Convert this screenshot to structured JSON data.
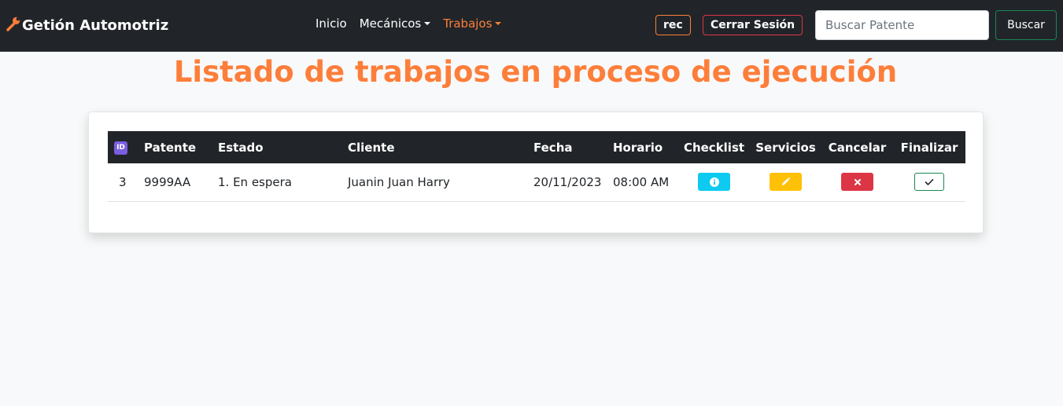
{
  "navbar": {
    "brand": "Getión Automotriz",
    "links": [
      {
        "label": "Inicio"
      },
      {
        "label": "Mecánicos"
      },
      {
        "label": "Trabajos"
      }
    ],
    "user": "rec",
    "logout": "Cerrar Sesión",
    "search_placeholder": "Buscar Patente",
    "search_button": "Buscar"
  },
  "page": {
    "title": "Listado de trabajos en proceso de ejecución"
  },
  "table": {
    "headers": {
      "id_icon": "ID",
      "patente": "Patente",
      "estado": "Estado",
      "cliente": "Cliente",
      "fecha": "Fecha",
      "horario": "Horario",
      "checklist": "Checklist",
      "servicios": "Servicios",
      "cancelar": "Cancelar",
      "finalizar": "Finalizar"
    },
    "rows": [
      {
        "id": "3",
        "patente": "9999AA",
        "estado": "1. En espera",
        "cliente": "Juanin Juan Harry",
        "fecha": "20/11/2023",
        "horario": "08:00 AM"
      }
    ]
  },
  "colors": {
    "accent": "#fd7e3a",
    "navbar_bg": "#212529",
    "info": "#0dcaf0",
    "warning": "#ffc107",
    "danger": "#dc3545",
    "success": "#198754"
  },
  "icons": [
    "wrench-icon",
    "id-icon",
    "info-icon",
    "pencil-icon",
    "close-icon",
    "check-icon"
  ]
}
